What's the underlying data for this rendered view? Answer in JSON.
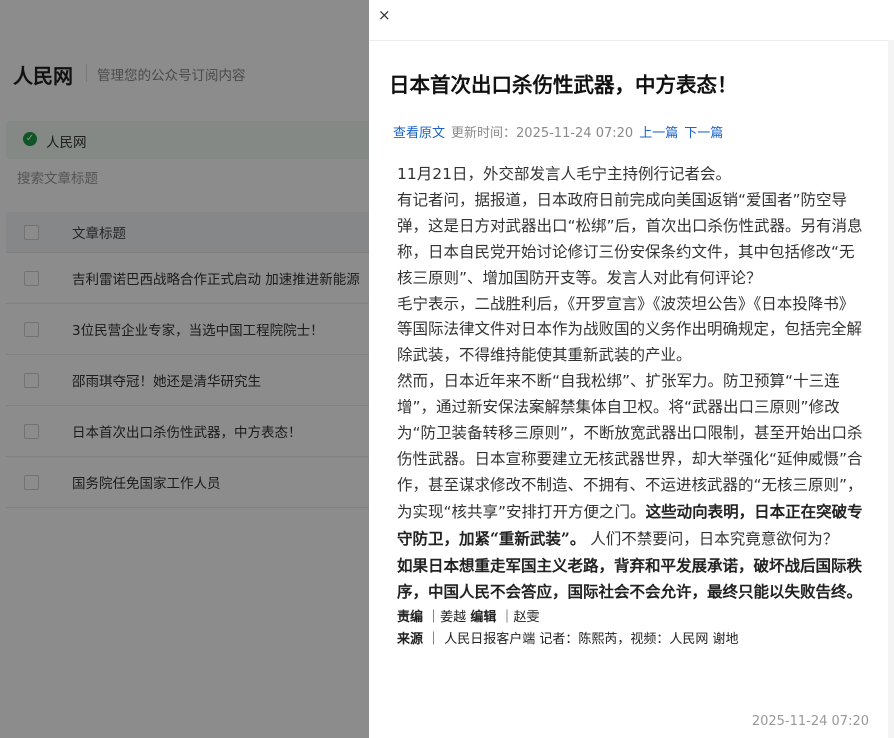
{
  "background": {
    "title": "人民网",
    "subtitle": "管理您的公众号订阅内容",
    "account": "人民网",
    "search_placeholder": "搜索文章标题",
    "table_header": "文章标题",
    "rows": [
      "吉利雷诺巴西战略合作正式启动 加速推进新能源",
      "3位民营企业专家，当选中国工程院院士！",
      "邵雨琪夺冠！她还是清华研究生",
      "日本首次出口杀伤性武器，中方表态！",
      "国务院任免国家工作人员"
    ]
  },
  "drawer": {
    "close": "×",
    "title": "日本首次出口杀伤性武器，中方表态！",
    "view_original": "查看原文",
    "update_label": "更新时间：",
    "update_time": "2025-11-24 07:20",
    "prev": "上一篇",
    "next": "下一篇",
    "paragraphs": [
      "11月21日，外交部发言人毛宁主持例行记者会。",
      "有记者问，据报道，日本政府日前完成向美国返销“爱国者”防空导弹，这是日方对武器出口“松绑”后，首次出口杀伤性武器。另有消息称，日本自民党开始讨论修订三份安保条约文件，其中包括修改“无核三原则”、增加国防开支等。发言人对此有何评论？",
      "毛宁表示，二战胜利后，《开罗宣言》《波茨坦公告》《日本投降书》等国际法律文件对日本作为战败国的义务作出明确规定，包括完全解除武装，不得维持能使其重新武装的产业。"
    ],
    "p4_normal": "然而，日本近年来不断“自我松绑”、扩张军力。防卫预算“十三连增”，通过新安保法案解禁集体自卫权。将“武器出口三原则”修改为“防卫装备转移三原则”，不断放宽武器出口限制，甚至开始出口杀伤性武器。日本宣称要建立无核武器世界，却大举强化“延伸威慑”合作，甚至谋求修改不制造、不拥有、不运进核武器的“无核三原则”，为实现“核共享”安排打开方便之门。",
    "p4_bold": "这些动向表明，日本正在突破专守防卫，加紧“重新武装”。",
    "p4_tail": "人们不禁要问，日本究竟意欲何为？",
    "closing_bold": "如果日本想重走军国主义老路，背弃和平发展承诺，破坏战后国际秩序，中国人民不会答应，国际社会不会允许，最终只能以失败告终。",
    "credit_line1_label": "责编",
    "credit_line1_a": "姜越",
    "credit_line1_label2": "编辑",
    "credit_line1_b": "赵雯",
    "credit_line2_label": "来源",
    "credit_line2_text": "人民日报客户端 记者：陈熙芮，视频：人民网 谢地",
    "footer_time": "2025-11-24 07:20"
  }
}
